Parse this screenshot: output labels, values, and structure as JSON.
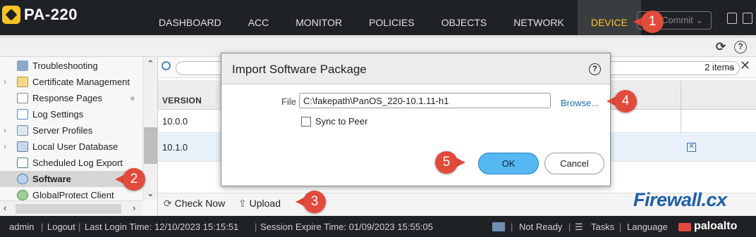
{
  "app": {
    "name": "PA-220"
  },
  "nav": {
    "tabs": [
      {
        "label": "DASHBOARD"
      },
      {
        "label": "ACC"
      },
      {
        "label": "MONITOR"
      },
      {
        "label": "POLICIES"
      },
      {
        "label": "OBJECTS"
      },
      {
        "label": "NETWORK"
      },
      {
        "label": "DEVICE",
        "active": true
      }
    ],
    "commit_label": "Commit"
  },
  "sidebar": {
    "items": [
      {
        "label": "Troubleshooting",
        "icon": "wrench-icon"
      },
      {
        "label": "Certificate Management",
        "icon": "certificate-icon"
      },
      {
        "label": "Response Pages",
        "icon": "page-icon"
      },
      {
        "label": "Log Settings",
        "icon": "log-icon"
      },
      {
        "label": "Server Profiles",
        "icon": "server-icon"
      },
      {
        "label": "Local User Database",
        "icon": "database-icon"
      },
      {
        "label": "Scheduled Log Export",
        "icon": "export-icon"
      },
      {
        "label": "Software",
        "icon": "software-icon",
        "selected": true
      },
      {
        "label": "GlobalProtect Client",
        "icon": "globe-icon"
      }
    ]
  },
  "main": {
    "items_count": "2 items",
    "columns": [
      "VERSION"
    ],
    "rows": [
      {
        "version": "10.0.0"
      },
      {
        "version": "10.1.0"
      }
    ],
    "actions": {
      "check_now": "Check Now",
      "upload": "Upload"
    }
  },
  "dialog": {
    "title": "Import Software Package",
    "file_label": "File",
    "file_value": "C:\\fakepath\\PanOS_220-10.1.11-h1",
    "browse_label": "Browse...",
    "sync_label": "Sync to Peer",
    "ok_label": "OK",
    "cancel_label": "Cancel"
  },
  "callouts": [
    "1",
    "2",
    "3",
    "4",
    "5"
  ],
  "status": {
    "user": "admin",
    "logout": "Logout",
    "last_login": "Last Login Time: 12/10/2023 15:15:51",
    "session_expire": "Session Expire Time: 01/09/2023 15:55:05",
    "not_ready": "Not Ready",
    "tasks": "Tasks",
    "language": "Language",
    "vendor": "paloalto"
  },
  "watermark": "Firewall.cx",
  "colors": {
    "topbar": "#1f2225",
    "active_tab_text": "#f6c324",
    "callout": "#e24a3b",
    "ok_button": "#55b8f2",
    "link": "#1a6fb5"
  }
}
